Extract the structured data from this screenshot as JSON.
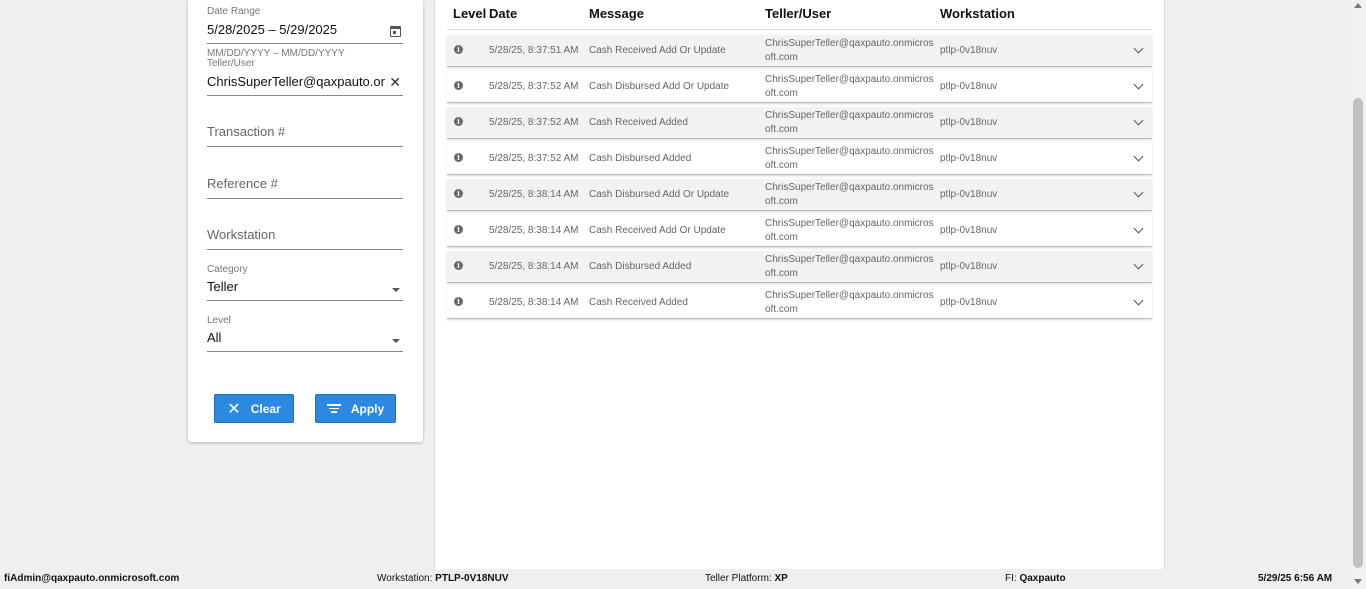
{
  "filters": {
    "date_range": {
      "label": "Date Range",
      "value": "5/28/2025 – 5/29/2025",
      "hint": "MM/DD/YYYY – MM/DD/YYYY"
    },
    "teller_user": {
      "label": "Teller/User",
      "value": "ChrisSuperTeller@qaxpauto.on"
    },
    "transaction": {
      "placeholder": "Transaction #"
    },
    "reference": {
      "placeholder": "Reference #"
    },
    "workstation": {
      "placeholder": "Workstation"
    },
    "category": {
      "label": "Category",
      "value": "Teller"
    },
    "level": {
      "label": "Level",
      "value": "All"
    },
    "clear_label": "Clear",
    "apply_label": "Apply"
  },
  "table": {
    "columns": {
      "level": "Level",
      "date": "Date",
      "message": "Message",
      "user": "Teller/User",
      "workstation": "Workstation"
    },
    "rows": [
      {
        "date": "5/28/25, 8:37:51 AM",
        "message": "Cash Received Add Or Update",
        "user": "ChrisSuperTeller@qaxpauto.onmicrosoft.com",
        "workstation": "ptlp-0v18nuv"
      },
      {
        "date": "5/28/25, 8:37:52 AM",
        "message": "Cash Disbursed Add Or Update",
        "user": "ChrisSuperTeller@qaxpauto.onmicrosoft.com",
        "workstation": "ptlp-0v18nuv"
      },
      {
        "date": "5/28/25, 8:37:52 AM",
        "message": "Cash Received Added",
        "user": "ChrisSuperTeller@qaxpauto.onmicrosoft.com",
        "workstation": "ptlp-0v18nuv"
      },
      {
        "date": "5/28/25, 8:37:52 AM",
        "message": "Cash Disbursed Added",
        "user": "ChrisSuperTeller@qaxpauto.onmicrosoft.com",
        "workstation": "ptlp-0v18nuv"
      },
      {
        "date": "5/28/25, 8:38:14 AM",
        "message": "Cash Disbursed Add Or Update",
        "user": "ChrisSuperTeller@qaxpauto.onmicrosoft.com",
        "workstation": "ptlp-0v18nuv"
      },
      {
        "date": "5/28/25, 8:38:14 AM",
        "message": "Cash Received Add Or Update",
        "user": "ChrisSuperTeller@qaxpauto.onmicrosoft.com",
        "workstation": "ptlp-0v18nuv"
      },
      {
        "date": "5/28/25, 8:38:14 AM",
        "message": "Cash Disbursed Added",
        "user": "ChrisSuperTeller@qaxpauto.onmicrosoft.com",
        "workstation": "ptlp-0v18nuv"
      },
      {
        "date": "5/28/25, 8:38:14 AM",
        "message": "Cash Received Added",
        "user": "ChrisSuperTeller@qaxpauto.onmicrosoft.com",
        "workstation": "ptlp-0v18nuv"
      }
    ]
  },
  "status_bar": {
    "user": "fiAdmin@qaxpauto.onmicrosoft.com",
    "workstation_label": "Workstation:",
    "workstation_value": "PTLP-0V18NUV",
    "platform_label": "Teller Platform:",
    "platform_value": "XP",
    "fi_label": "FI:",
    "fi_value": "Qaxpauto",
    "datetime": "5/29/25 6:56 AM"
  },
  "colors": {
    "primary_button": "#2d89e0",
    "row_alt": "#f2f2f2"
  }
}
